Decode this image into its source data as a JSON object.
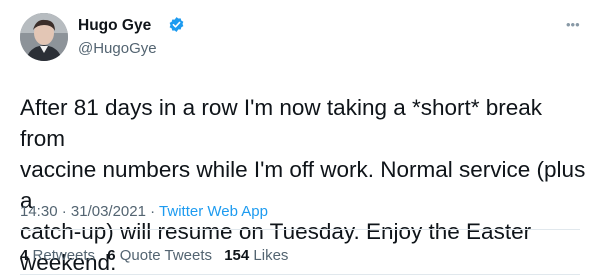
{
  "author": {
    "display_name": "Hugo Gye",
    "handle": "@HugoGye",
    "verified": true,
    "avatar_icon": "profile-photo"
  },
  "tweet": {
    "text": "After 81 days in a row I'm now taking a *short* break from\nvaccine numbers while I'm off work. Normal service (plus a\ncatch-up) will resume on Tuesday. Enjoy the Easter weekend.",
    "time": "14:30",
    "date": "31/03/2021",
    "separator": " · ",
    "source_app": "Twitter Web App"
  },
  "stats": {
    "retweets": {
      "count": "4",
      "label": "Retweets"
    },
    "quote_tweets": {
      "count": "6",
      "label": "Quote Tweets"
    },
    "likes": {
      "count": "154",
      "label": "Likes"
    }
  },
  "more_icon": "more-horizontal-icon",
  "colors": {
    "link": "#1d9bf0",
    "text": "#0f1419",
    "secondary": "#536471",
    "verified": "#1d9bf0",
    "divider": "#e1e8ed"
  }
}
